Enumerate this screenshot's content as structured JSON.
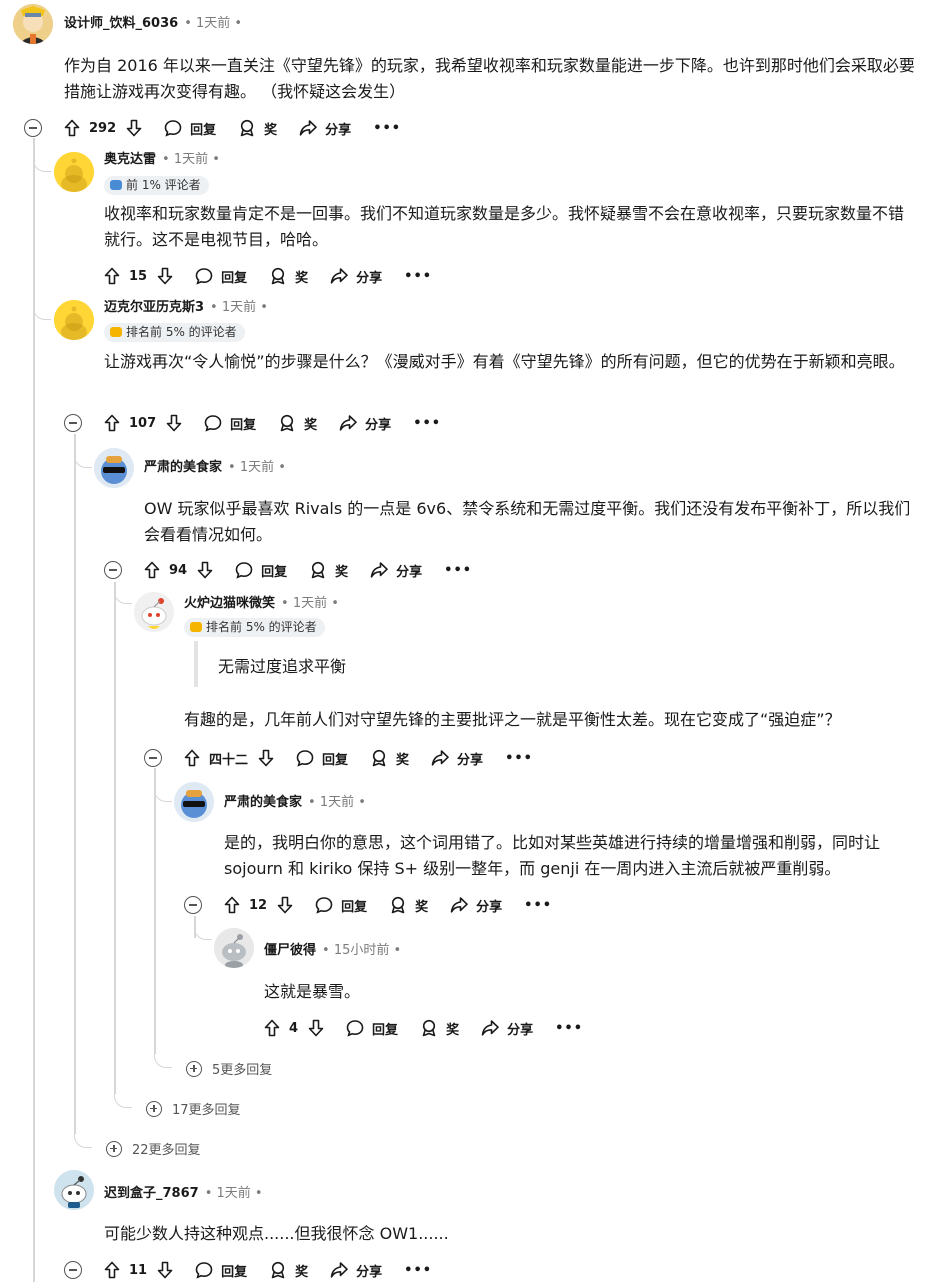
{
  "labels": {
    "reply": "回复",
    "award": "奖",
    "share": "分享",
    "more_options": "•••"
  },
  "comments": [
    {
      "user": "设计师_饮料_6036",
      "time": "• 1天前 •",
      "body": "作为自 2016 年以来一直关注《守望先锋》的玩家，我希望收视率和玩家数量能进一步下降。也许到那时他们会采取必要措施让游戏再次变得有趣。 （我怀疑这会发生）",
      "votes": "292"
    },
    {
      "user": "奥克达雷",
      "time": "• 1天前 •",
      "flair": "前 1% 评论者",
      "body": "收视率和玩家数量肯定不是一回事。我们不知道玩家数量是多少。我怀疑暴雪不会在意收视率，只要玩家数量不错就行。这不是电视节目，哈哈。",
      "votes": "15"
    },
    {
      "user": "迈克尔亚历克斯3",
      "time": "• 1天前 •",
      "flair": "排名前 5% 的评论者",
      "body": "让游戏再次“令人愉悦”的步骤是什么？《漫威对手》有着《守望先锋》的所有问题，但它的优势在于新颖和亮眼。",
      "votes": "107"
    },
    {
      "user": "严肃的美食家",
      "time": "• 1天前 •",
      "body": "OW 玩家似乎最喜欢 Rivals 的一点是 6v6、禁令系统和无需过度平衡。我们还没有发布平衡补丁，所以我们会看看情况如何。",
      "votes": "94"
    },
    {
      "user": "火炉边猫咪微笑",
      "time": "• 1天前 •",
      "flair": "排名前 5% 的评论者",
      "quote": "无需过度追求平衡",
      "body": "有趣的是，几年前人们对守望先锋的主要批评之一就是平衡性太差。现在它变成了“强迫症”？",
      "votes": "四十二"
    },
    {
      "user": "严肃的美食家",
      "time": "• 1天前 •",
      "body": "是的，我明白你的意思，这个词用错了。比如对某些英雄进行持续的增量增强和削弱，同时让 sojourn 和 kiriko 保持 S+ 级别一整年，而 genji 在一周内进入主流后就被严重削弱。",
      "votes": "12"
    },
    {
      "user": "僵尸彼得",
      "time": "• 15小时前 •",
      "body": "这就是暴雪。",
      "votes": "4"
    },
    {
      "user": "迟到盒子_7867",
      "time": "• 1天前 •",
      "body": "可能少数人持这种观点......但我很怀念 OW1......",
      "votes": "11"
    }
  ],
  "more_replies": [
    "5更多回复",
    "17更多回复",
    "22更多回复"
  ]
}
